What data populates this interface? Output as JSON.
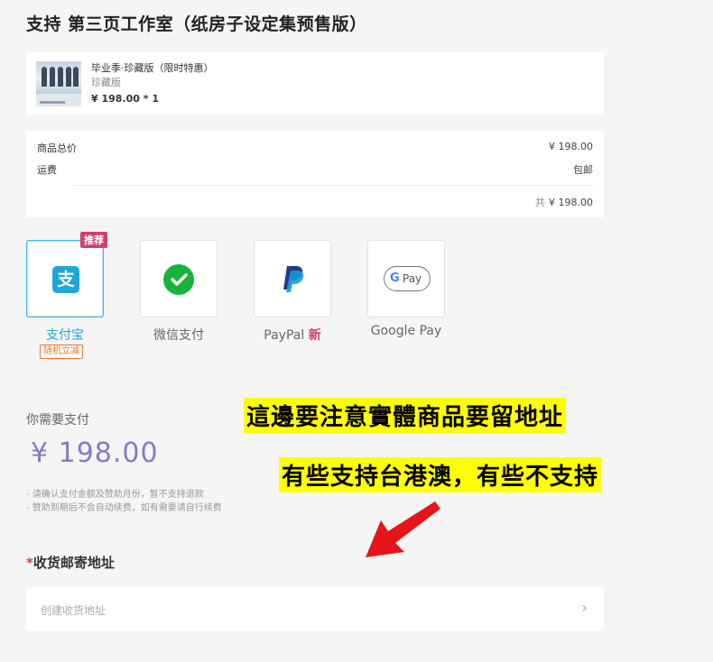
{
  "page_title": "支持 第三页工作室（纸房子设定集预售版）",
  "product": {
    "name": "毕业季·珍藏版（限时特惠）",
    "variant": "珍藏版",
    "price_line": "¥ 198.00 * 1"
  },
  "summary": {
    "total_goods_label": "商品总价",
    "total_goods_value": "¥ 198.00",
    "shipping_label": "运费",
    "shipping_value": "包邮",
    "grand_prefix": "共",
    "grand_value": "¥ 198.00"
  },
  "payment": {
    "recommend_badge": "推荐",
    "random_discount_badge": "随机立减",
    "options": [
      {
        "label": "支付宝",
        "icon": "alipay-icon",
        "selected": true
      },
      {
        "label": "微信支付",
        "icon": "wechat-icon",
        "selected": false
      },
      {
        "label": "PayPal",
        "new_tag": "新",
        "icon": "paypal-icon",
        "selected": false
      },
      {
        "label": "Google Pay",
        "icon": "google-pay-icon",
        "selected": false
      }
    ],
    "alipay_glyph": "支",
    "gpay_g": "G",
    "gpay_pay": "Pay"
  },
  "amount": {
    "label": "你需要支付",
    "value": "¥  198.00"
  },
  "notes": [
    "- 请确认支付金额及赞助月份，暂不支持退款",
    "- 赞助到期后不会自动续费，如有需要请自行续费"
  ],
  "address": {
    "required_mark": "*",
    "title": "收货邮寄地址",
    "placeholder": "创建收货地址",
    "chevron": "›"
  },
  "annotations": {
    "line1": "這邊要注意實體商品要留地址",
    "line2": "有些支持台港澳，有些不支持"
  },
  "colors": {
    "accent": "#1ea6d8",
    "amount": "#8a78c8",
    "badge": "#d43f6a",
    "discount": "#e77730",
    "highlight": "#ffff00",
    "arrow": "#e8141b"
  }
}
